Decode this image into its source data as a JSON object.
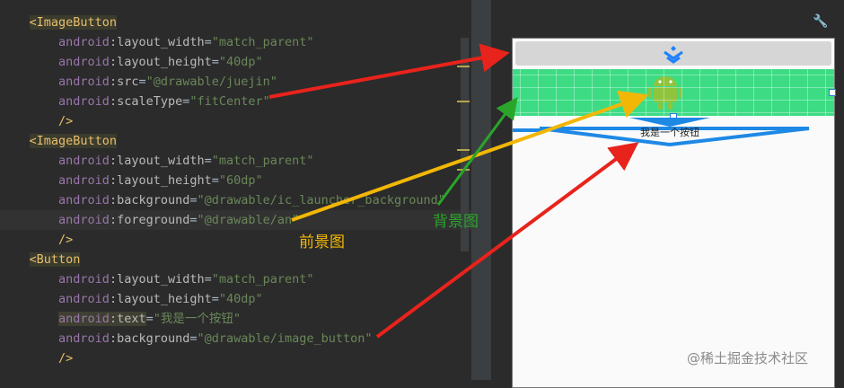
{
  "code_lines": [
    {
      "text": "<ImageButton"
    },
    {
      "ns": "android",
      "name": "layout_width",
      "value": "\"match_parent\""
    },
    {
      "ns": "android",
      "name": "layout_height",
      "value": "\"40dp\""
    },
    {
      "ns": "android",
      "name": "src",
      "value": "\"@drawable/juejin\""
    },
    {
      "ns": "android",
      "name": "scaleType",
      "value": "\"fitCenter\""
    },
    {
      "text": "/>"
    },
    {
      "text": "<ImageButton"
    },
    {
      "ns": "android",
      "name": "layout_width",
      "value": "\"match_parent\""
    },
    {
      "ns": "android",
      "name": "layout_height",
      "value": "\"60dp\""
    },
    {
      "ns": "android",
      "name": "background",
      "value": "\"@drawable/ic_launcher_background\""
    },
    {
      "ns": "android",
      "name": "foreground",
      "value": "\"@drawable/an\""
    },
    {
      "text": "/>"
    },
    {
      "text": "<Button"
    },
    {
      "ns": "android",
      "name": "layout_width",
      "value": "\"match_parent\""
    },
    {
      "ns": "android",
      "name": "layout_height",
      "value": "\"40dp\""
    },
    {
      "ns": "android",
      "name": "text",
      "value": "\"我是一个按钮\""
    },
    {
      "ns": "android",
      "name": "background",
      "value": "\"@drawable/image_button\""
    },
    {
      "text": "/>"
    }
  ],
  "preview": {
    "button_text": "我是一个按钮"
  },
  "annotations": {
    "background_label": "背景图",
    "foreground_label": "前景图"
  },
  "watermark": "@稀土掘金技术社区",
  "icons": {
    "wrench": "wrench-icon",
    "juejin_logo": "juejin-logo-icon",
    "android_robot": "android-robot-icon"
  },
  "colors": {
    "red_arrow": "#e8231c",
    "yellow_arrow": "#f2b705",
    "green_arrow": "#2aa52a",
    "android_green": "#3ddc84",
    "button_blue": "#1e88e5"
  }
}
